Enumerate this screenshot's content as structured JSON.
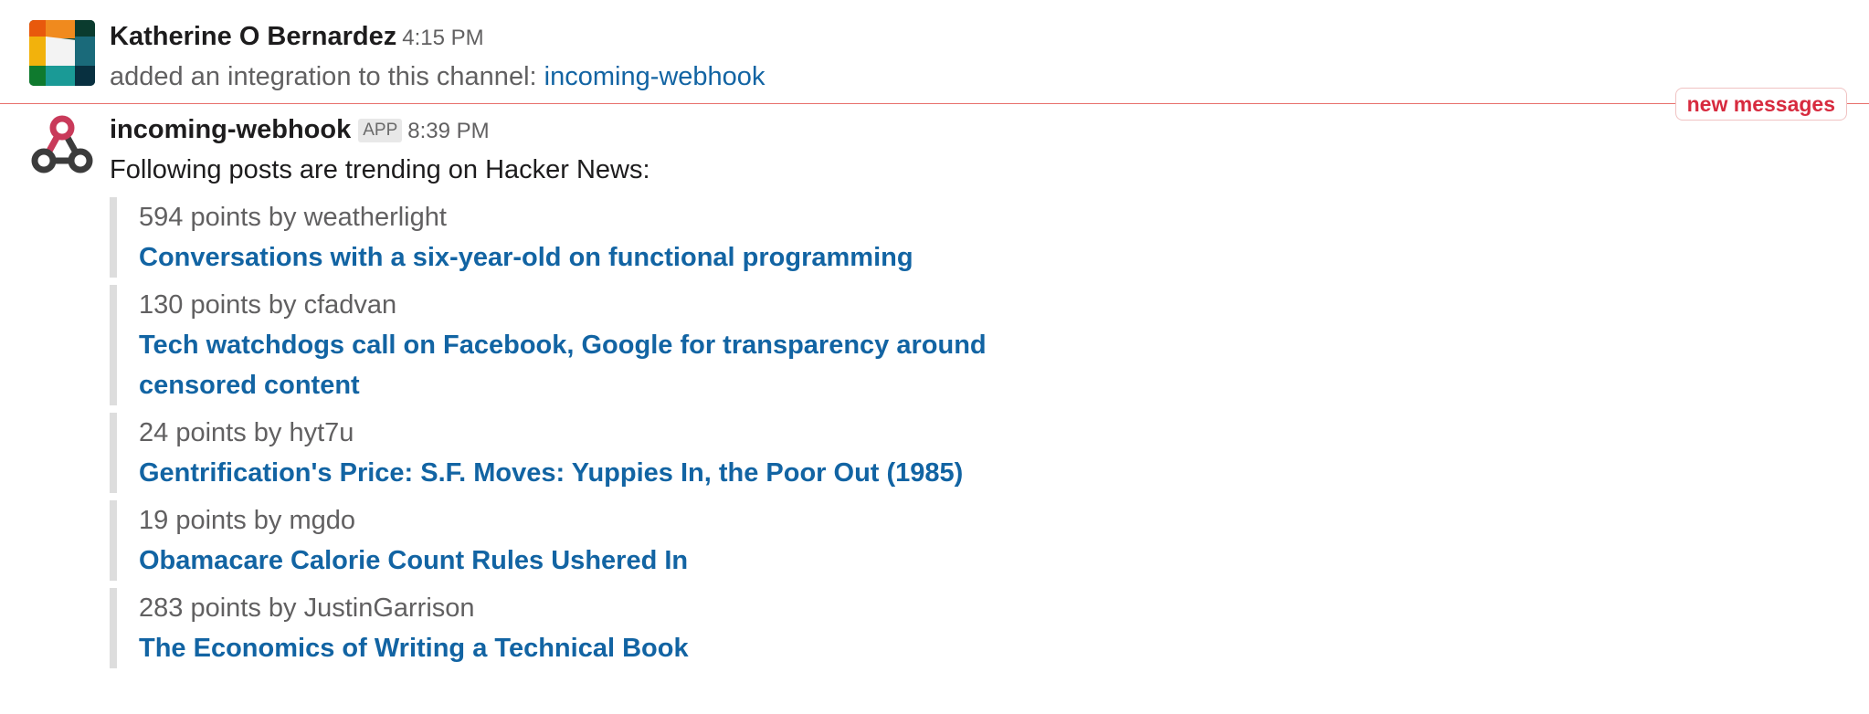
{
  "messages": [
    {
      "sender": "Katherine O Bernardez",
      "time": "4:15 PM",
      "text": "added an integration to this channel:",
      "link": "incoming-webhook",
      "avatar_icon": "user-avatar-icon",
      "avatar_colors": [
        "#e8590c",
        "#f2a20c",
        "#0b6a3b",
        "#1a8a8a",
        "#083b46",
        "#f0f0f0"
      ]
    },
    {
      "sender": "incoming-webhook",
      "badge": "APP",
      "time": "8:39 PM",
      "text": "Following posts are trending on Hacker News:",
      "avatar_icon": "webhook-icon",
      "avatar_colors": [
        "#c93a5a",
        "#3c3c3c"
      ]
    }
  ],
  "divider": {
    "label": "new messages",
    "color": "#e8706c"
  },
  "attachments": [
    {
      "meta": "594 points by weatherlight",
      "title": "Conversations with a six-year-old on functional programming"
    },
    {
      "meta": "130 points by cfadvan",
      "title": "Tech watchdogs call on Facebook, Google for transparency around censored content"
    },
    {
      "meta": "24 points by hyt7u",
      "title": "Gentrification's Price: S.F. Moves: Yuppies In, the Poor Out (1985)"
    },
    {
      "meta": "19 points by mgdo",
      "title": "Obamacare Calorie Count Rules Ushered In"
    },
    {
      "meta": "283 points by JustinGarrison",
      "title": "The Economics of Writing a Technical Book"
    }
  ],
  "colors": {
    "link": "#1264a3",
    "muted": "#616061",
    "new_messages": "#d72b3f",
    "attachment_bar": "#dddddd"
  }
}
